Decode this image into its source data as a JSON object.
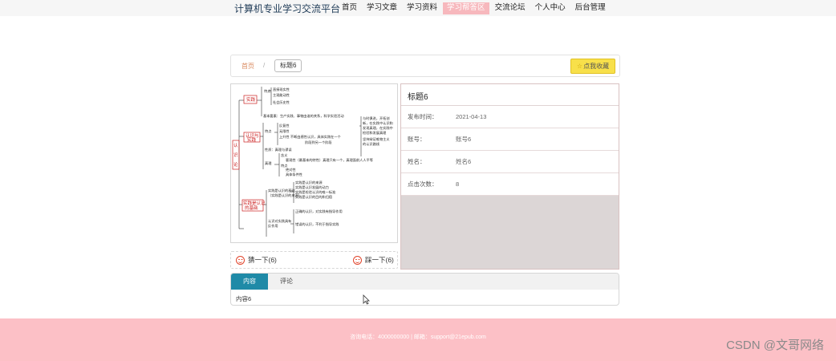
{
  "header": {
    "site_title": "计算机专业学习交流平台",
    "nav": [
      "首页",
      "学习文章",
      "学习资料",
      "学习帮答区",
      "交流论坛",
      "个人中心",
      "后台管理"
    ],
    "active_index": 3
  },
  "breadcrumb": {
    "home": "首页",
    "separator": "/",
    "current": "标题6"
  },
  "favorite_button": "点我收藏",
  "detail": {
    "title": "标题6",
    "rows": [
      {
        "label": "发布时间：",
        "value": "2021-04-13"
      },
      {
        "label": "账号：",
        "value": "账号6"
      },
      {
        "label": "姓名：",
        "value": "姓名6"
      },
      {
        "label": "点击次数：",
        "value": "8"
      }
    ]
  },
  "pager": {
    "prev": "猜一下(6)",
    "next": "踩一下(6)"
  },
  "tabs": {
    "items": [
      "内容",
      "评论"
    ],
    "active": 0,
    "content": "内容6"
  },
  "footer": {
    "text": "咨询电话：4000000000 | 邮箱：support@21epub.com"
  },
  "watermark": "CSDN @文哥网络",
  "mindmap": {
    "root": "认识论",
    "nodes": [
      "实践",
      "特点",
      "直接现实性",
      "主观能动性",
      "社会历史性",
      "基本要素：生产实践、事物由谁的关系，科学实验活动",
      "认识与实践",
      "特点",
      "反复性",
      "无限性",
      "上升性",
      "不断由感性认识，具体实践在一个阶段到另一个阶段",
      "性质：真理与谬误",
      "真理",
      "含义",
      "特点",
      "客观性（最基本的特性）真理只有一个，真理面前人人平等",
      "绝对性",
      "具体条件性",
      "实践是认识的基础",
      "实践是认识的来源",
      "实践是认识发展的动力",
      "实践是检验认识的唯一标准",
      "实践是认识的目的和归宿",
      "实践检验真理的具体性",
      "认识对实践具有反作用",
      "正确的认识，对实践有指导作用",
      "错误的认识，不利于指导实践",
      "与时俱进，开拓创新，在实践中认识和发现真理，在实践中检验和发展真理",
      "坚持辩证唯物主义的认识路线"
    ]
  }
}
